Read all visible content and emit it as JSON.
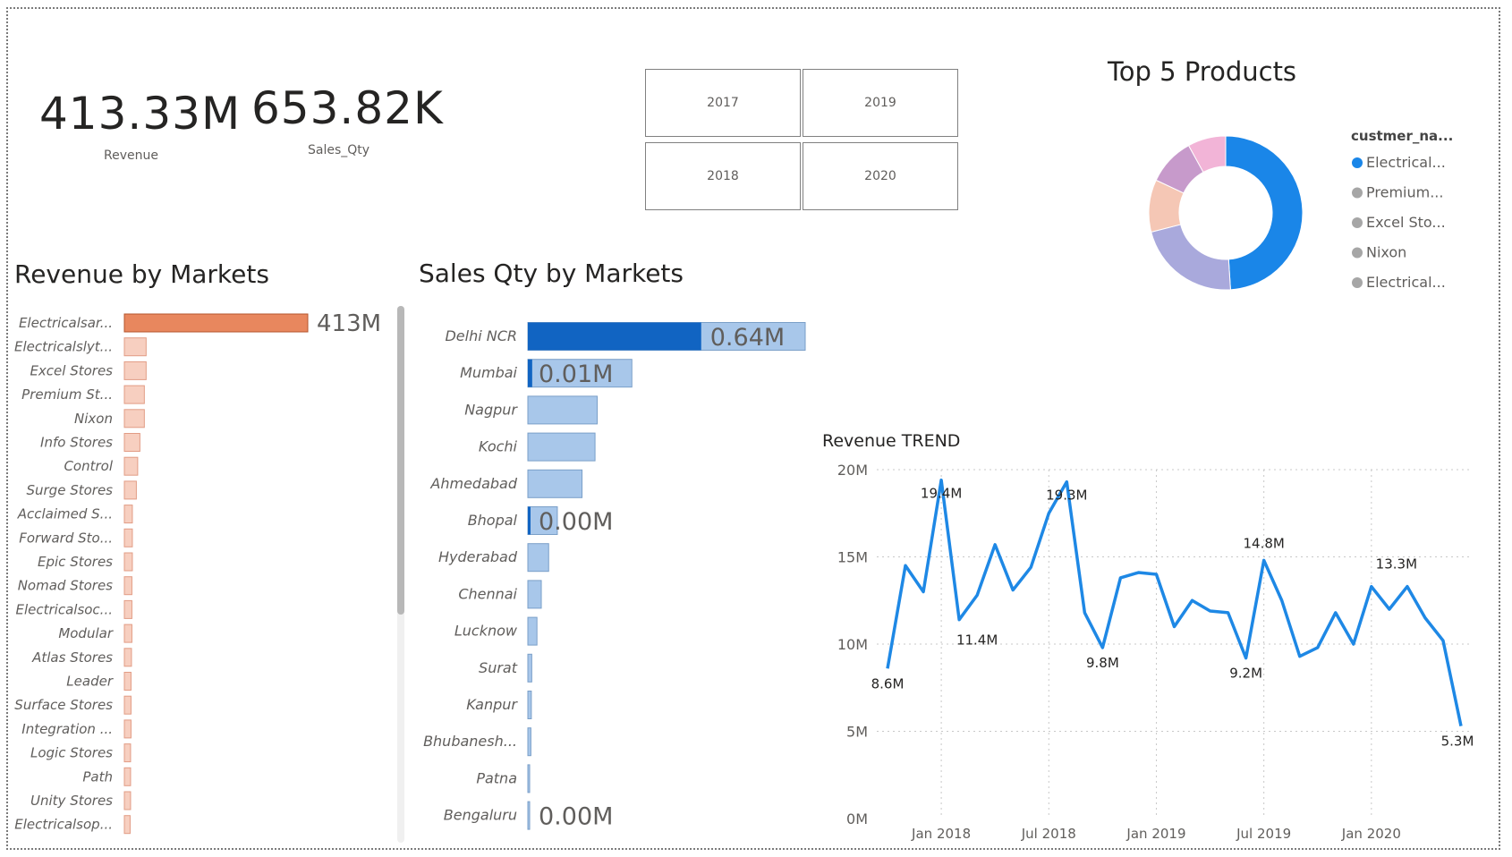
{
  "kpis": {
    "revenue": {
      "value": "413.33M",
      "label": "Revenue"
    },
    "sales_qty": {
      "value": "653.82K",
      "label": "Sales_Qty"
    }
  },
  "year_slicer": [
    "2017",
    "2019",
    "2018",
    "2020"
  ],
  "colors": {
    "revenue_bar_top": "#E8875E",
    "revenue_bar": "#F7CFC0",
    "sales_bar_highlight": "#1164C2",
    "sales_bar": "#A8C7EA",
    "line": "#1E88E5",
    "donut": [
      "#1A86E8",
      "#A9A9DC",
      "#F5C7B5",
      "#C79ACB",
      "#F2B4D7"
    ]
  },
  "chart_data": [
    {
      "type": "bar",
      "orientation": "horizontal",
      "title": "Revenue by Markets",
      "categories": [
        "Electricalsar...",
        "Electricalslyt...",
        "Excel Stores",
        "Premium St...",
        "Nixon",
        "Info Stores",
        "Control",
        "Surge Stores",
        "Acclaimed S...",
        "Forward Sto...",
        "Epic Stores",
        "Nomad Stores",
        "Electricalsoc...",
        "Modular",
        "Atlas Stores",
        "Leader",
        "Surface Stores",
        "Integration ...",
        "Logic Stores",
        "Path",
        "Unity Stores",
        "Electricalsop..."
      ],
      "values": [
        413,
        49,
        49,
        45,
        45,
        35,
        30,
        27,
        18,
        18,
        18,
        17,
        17,
        17,
        16,
        15,
        15,
        15,
        14,
        14,
        14,
        13
      ],
      "unit": "M",
      "data_labels": [
        "413M"
      ]
    },
    {
      "type": "bar",
      "orientation": "horizontal",
      "title": "Sales Qty by Markets",
      "categories": [
        "Delhi NCR",
        "Mumbai",
        "Nagpur",
        "Kochi",
        "Ahmedabad",
        "Bhopal",
        "Hyderabad",
        "Chennai",
        "Lucknow",
        "Surat",
        "Kanpur",
        "Bhubanesh...",
        "Patna",
        "Bengaluru"
      ],
      "values": [
        0.64,
        0.24,
        0.16,
        0.155,
        0.125,
        0.068,
        0.048,
        0.031,
        0.021,
        0.009,
        0.008,
        0.007,
        0.003,
        0.001
      ],
      "highlight_values": [
        0.4,
        0.01,
        0,
        0,
        0,
        0.004,
        0,
        0,
        0,
        0,
        0,
        0,
        0,
        0
      ],
      "unit": "M",
      "data_labels": {
        "Delhi NCR": "0.64M",
        "Mumbai": "0.01M",
        "Bhopal": "0.00M",
        "Bengaluru": "0.00M"
      }
    },
    {
      "type": "pie",
      "donut": true,
      "title": "Top 5 Products",
      "legend_title": "custmer_na...",
      "legend_position": "right",
      "labels": [
        "Electrical...",
        "Premium...",
        "Excel Sto...",
        "Nixon",
        "Electrical..."
      ],
      "values": [
        49,
        22,
        11,
        10,
        8
      ]
    },
    {
      "type": "line",
      "title": "Revenue TREND",
      "ylabel": "",
      "xlabel": "",
      "x_tick_labels": [
        "Jan 2018",
        "Jul 2018",
        "Jan 2019",
        "Jul 2019",
        "Jan 2020"
      ],
      "y_tick_labels": [
        "0M",
        "5M",
        "10M",
        "15M",
        "20M"
      ],
      "ylim": [
        0,
        20
      ],
      "grid": true,
      "x": [
        "2017-10",
        "2017-11",
        "2017-12",
        "2018-01",
        "2018-02",
        "2018-03",
        "2018-04",
        "2018-05",
        "2018-06",
        "2018-07",
        "2018-08",
        "2018-09",
        "2018-10",
        "2018-11",
        "2018-12",
        "2019-01",
        "2019-02",
        "2019-03",
        "2019-04",
        "2019-05",
        "2019-06",
        "2019-07",
        "2019-08",
        "2019-09",
        "2019-10",
        "2019-11",
        "2019-12",
        "2020-01",
        "2020-02",
        "2020-03",
        "2020-04",
        "2020-05",
        "2020-06"
      ],
      "values": [
        8.6,
        14.5,
        13.0,
        19.4,
        11.4,
        12.8,
        15.7,
        13.1,
        14.4,
        17.5,
        19.3,
        11.8,
        9.8,
        13.8,
        14.1,
        14.0,
        11.0,
        12.5,
        11.9,
        11.8,
        9.2,
        14.8,
        12.5,
        9.3,
        9.8,
        11.8,
        10.0,
        13.3,
        12.0,
        13.3,
        11.5,
        10.2,
        5.3
      ],
      "point_labels": [
        "8.6M",
        "19.4M",
        "11.4M",
        "19.3M",
        "9.8M",
        "14.8M",
        "9.2M",
        "13.3M",
        "5.3M"
      ]
    }
  ]
}
